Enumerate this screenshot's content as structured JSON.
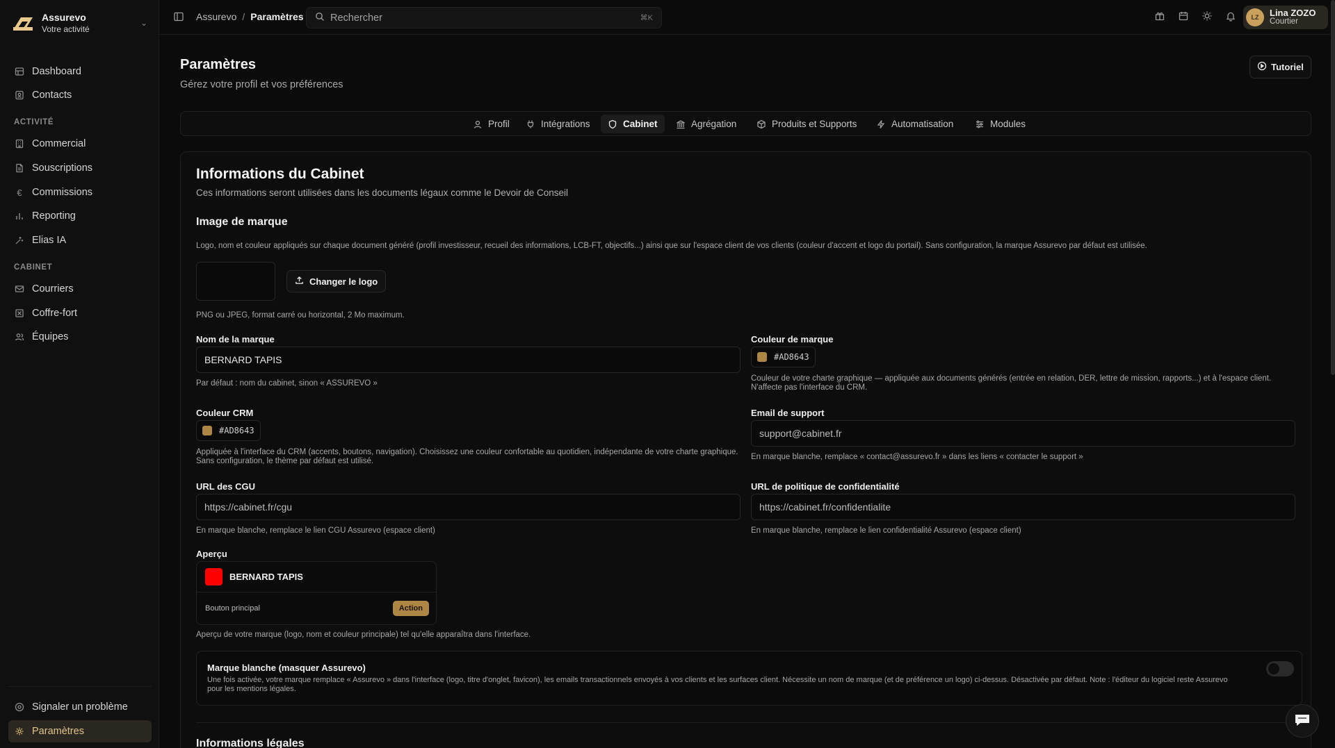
{
  "sidebar": {
    "brand_name": "Assurevo",
    "brand_sub": "Votre activité",
    "items": [
      {
        "label": "Dashboard",
        "icon": "dashboard-icon"
      },
      {
        "label": "Contacts",
        "icon": "contacts-icon"
      }
    ],
    "section_activity": "ACTIVITÉ",
    "activity_items": [
      {
        "label": "Commercial",
        "icon": "building-icon"
      },
      {
        "label": "Souscriptions",
        "icon": "document-icon"
      },
      {
        "label": "Commissions",
        "icon": "euro-icon"
      },
      {
        "label": "Reporting",
        "icon": "bar-chart-icon"
      },
      {
        "label": "Elias IA",
        "icon": "sparkles-icon"
      }
    ],
    "section_cabinet": "CABINET",
    "cabinet_items": [
      {
        "label": "Courriers",
        "icon": "mail-icon"
      },
      {
        "label": "Coffre-fort",
        "icon": "vault-icon"
      },
      {
        "label": "Équipes",
        "icon": "users-icon"
      }
    ],
    "footer_items": [
      {
        "label": "Signaler un problème",
        "icon": "help-icon"
      },
      {
        "label": "Paramètres",
        "icon": "gear-icon",
        "active": true
      }
    ]
  },
  "topbar": {
    "breadcrumb_root": "Assurevo",
    "breadcrumb_sep": "/",
    "breadcrumb_current": "Paramètres",
    "search_placeholder": "Rechercher",
    "search_shortcut": "⌘K",
    "user_initials": "LZ",
    "user_name": "Lina ZOZO",
    "user_role": "Courtier"
  },
  "page": {
    "title": "Paramètres",
    "subtitle": "Gérez votre profil et vos préférences",
    "tutorial_label": "Tutoriel"
  },
  "tabs": [
    {
      "label": "Profil",
      "icon": "user-icon"
    },
    {
      "label": "Intégrations",
      "icon": "plug-icon"
    },
    {
      "label": "Cabinet",
      "icon": "shield-icon",
      "active": true
    },
    {
      "label": "Agrégation",
      "icon": "bank-icon"
    },
    {
      "label": "Produits et Supports",
      "icon": "package-icon"
    },
    {
      "label": "Automatisation",
      "icon": "bolt-icon"
    },
    {
      "label": "Modules",
      "icon": "sliders-icon"
    }
  ],
  "cabinet": {
    "title": "Informations du Cabinet",
    "subtitle": "Ces informations seront utilisées dans les documents légaux comme le Devoir de Conseil",
    "brand_section_title": "Image de marque",
    "brand_section_desc": "Logo, nom et couleur appliqués sur chaque document généré (profil investisseur, recueil des informations, LCB-FT, objectifs...) ainsi que sur l'espace client de vos clients (couleur d'accent et logo du portail). Sans configuration, la marque Assurevo par défaut est utilisée.",
    "change_logo_label": "Changer le logo",
    "logo_hint": "PNG ou JPEG, format carré ou horizontal, 2 Mo maximum.",
    "brand_name_label": "Nom de la marque",
    "brand_name_value": "BERNARD TAPIS",
    "brand_name_help": "Par défaut : nom du cabinet, sinon « ASSUREVO »",
    "brand_color_label": "Couleur de marque",
    "brand_color_value": "#AD8643",
    "brand_color_help": "Couleur de votre charte graphique — appliquée aux documents générés (entrée en relation, DER, lettre de mission, rapports...) et à l'espace client. N'affecte pas l'interface du CRM.",
    "crm_color_label": "Couleur CRM",
    "crm_color_value": "#AD8643",
    "crm_color_help": "Appliquée à l'interface du CRM (accents, boutons, navigation). Choisissez une couleur confortable au quotidien, indépendante de votre charte graphique. Sans configuration, le thème par défaut est utilisé.",
    "support_email_label": "Email de support",
    "support_email_placeholder": "support@cabinet.fr",
    "support_email_help": "En marque blanche, remplace « contact@assurevo.fr » dans les liens « contacter le support »",
    "cgu_label": "URL des CGU",
    "cgu_placeholder": "https://cabinet.fr/cgu",
    "cgu_help": "En marque blanche, remplace le lien CGU Assurevo (espace client)",
    "privacy_label": "URL de politique de confidentialité",
    "privacy_placeholder": "https://cabinet.fr/confidentialite",
    "privacy_help": "En marque blanche, remplace le lien confidentialité Assurevo (espace client)",
    "preview_label": "Aperçu",
    "preview_name": "BERNARD TAPIS",
    "preview_logo_color": "#FF0000",
    "preview_button_caption": "Bouton principal",
    "preview_button_label": "Action",
    "preview_help": "Aperçu de votre marque (logo, nom et couleur principale) tel qu'elle apparaîtra dans l'interface.",
    "white_label_title": "Marque blanche (masquer Assurevo)",
    "white_label_desc": "Une fois activée, votre marque remplace « Assurevo » dans l'interface (logo, titre d'onglet, favicon), les emails transactionnels envoyés à vos clients et les surfaces client. Nécessite un nom de marque (et de préférence un logo) ci-dessus. Désactivée par défaut. Note : l'éditeur du logiciel reste Assurevo pour les mentions légales.",
    "white_label_enabled": false,
    "legal_title": "Informations légales"
  },
  "colors": {
    "accent": "#AD8643",
    "background": "#0B0B0B"
  }
}
